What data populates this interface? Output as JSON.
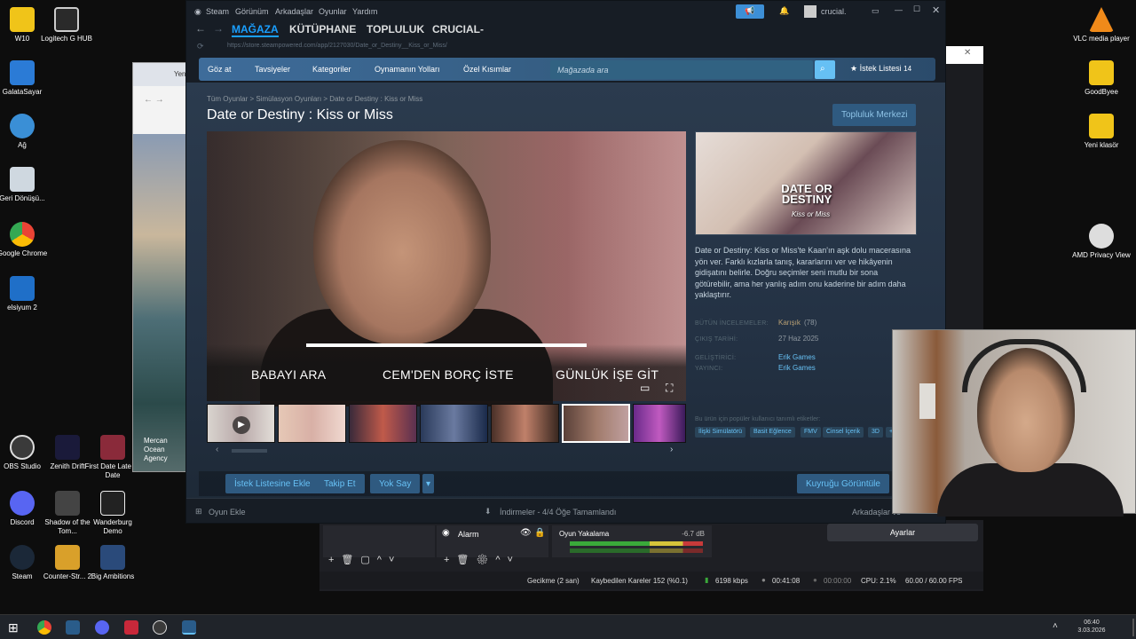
{
  "desktop": {
    "left_icons": [
      {
        "label": "W10",
        "color": "#f0c419"
      },
      {
        "label": "Logitech G HUB",
        "color": "#2a2a2a"
      },
      {
        "label": "GalataSayar",
        "color": "#2b7bd6"
      },
      {
        "label": "Ağ",
        "color": "#3a8fd6"
      },
      {
        "label": "Geri Dönüşü...",
        "color": "#cfd8e0"
      },
      {
        "label": "Google Chrome",
        "color": "#4285f4"
      },
      {
        "label": "elsiyum 2",
        "color": "#1f6fc8"
      },
      {
        "label": "OBS Studio",
        "color": "#3a3a3a"
      },
      {
        "label": "Zenith Drift",
        "color": "#1a1a3a"
      },
      {
        "label": "First Date Late To Date",
        "color": "#8a2a3a"
      },
      {
        "label": "Discord",
        "color": "#5865f2"
      },
      {
        "label": "Shadow of the Tom...",
        "color": "#444444"
      },
      {
        "label": "Wanderburg Demo",
        "color": "#222222"
      },
      {
        "label": "Steam",
        "color": "#1b2838"
      },
      {
        "label": "Counter-Str... 2",
        "color": "#d9a02a"
      },
      {
        "label": "Big Ambitions",
        "color": "#2a4a7a"
      }
    ],
    "right_icons": [
      {
        "label": "VLC media player",
        "color": "#f08a1a"
      },
      {
        "label": "GoodByee",
        "color": "#f0c419"
      },
      {
        "label": "Yeni klasör",
        "color": "#f0c419"
      },
      {
        "label": "AMD Privacy View",
        "color": "#dddddd"
      }
    ],
    "bg_window_tab": "Yen",
    "bg_window_side": "Mercan Ocean Agency"
  },
  "steam": {
    "menu": [
      "Steam",
      "Görünüm",
      "Arkadaşlar",
      "Oyunlar",
      "Yardım"
    ],
    "user": "crucial.",
    "main_tabs": [
      "MAĞAZA",
      "KÜTÜPHANE",
      "TOPLULUK",
      "CRUCIAL-"
    ],
    "url": "https://store.steampowered.com/app/2127030/Date_or_Destiny__Kiss_or_Miss/",
    "store_nav": [
      "Göz at",
      "Tavsiyeler",
      "Kategoriler",
      "Oynamanın Yolları",
      "Özel Kısımlar"
    ],
    "search_placeholder": "Mağazada ara",
    "wishlist_label": "İstek Listesi",
    "wishlist_count": "14",
    "breadcrumb": [
      "Tüm Oyunlar",
      "Simülasyon Oyunları",
      "Date or Destiny : Kiss or Miss"
    ],
    "game_title": "Date or Destiny : Kiss or Miss",
    "community_hub": "Topluluk Merkezi",
    "video_choices": [
      "BABAYI ARA",
      "CEM'DEN BORÇ İSTE",
      "GÜNLÜK İŞE GİT"
    ],
    "video_progress": 0.85,
    "capsule_title": "DATE OR DESTINY",
    "capsule_sub": "Kiss or Miss",
    "description": "Date or Destiny: Kiss or Miss'te Kaan'ın aşk dolu macerasına yön ver. Farklı kızlarla tanış, kararlarını ver ve hikâyenin gidişatını belirle. Doğru seçimler seni mutlu bir sona götürebilir, ama her yanlış adım onu kaderine bir adım daha yaklaştırır.",
    "meta": [
      {
        "label": "BÜTÜN İNCELEMELER:",
        "value": "Karışık",
        "extra": "(78)"
      },
      {
        "label": "ÇIKIŞ TARİHİ:",
        "value": "27 Haz 2025"
      },
      {
        "label": "GELİŞTİRİCİ:",
        "value": "Erik Games"
      },
      {
        "label": "YAYINCI:",
        "value": "Erik Games"
      }
    ],
    "tags_label": "Bu ürün için popüler kullanıcı tanımlı etiketler:",
    "tags": [
      "İlişki Simülatörü",
      "Basit Eğlence",
      "FMV",
      "Cinsel İçerik",
      "3D",
      "+"
    ],
    "actions": [
      "İstek Listesine Ekle",
      "Takip Et",
      "Yok Say"
    ],
    "queue_button": "Kuyruğu Görüntüle",
    "bottom_add_game": "Oyun Ekle",
    "bottom_downloads": "İndirmeler - 4/4 Öğe Tamamlandı",
    "bottom_friends": "Arkadaşlar ve"
  },
  "obs": {
    "source_alarm": "Alarm",
    "audio_source": "Oyun Yakalama",
    "audio_db": "-6.7 dB",
    "settings_btn": "Ayarlar",
    "status": {
      "delay": "Gecikme (2 san)",
      "dropped": "Kaybedilen Kareler 152 (%0.1)",
      "bitrate": "6198 kbps",
      "rec_time": "00:41:08",
      "stream_time": "00:00:00",
      "cpu": "CPU: 2.1%",
      "fps": "60.00 / 60.00 FPS"
    }
  },
  "taskbar": {
    "time": "06:40",
    "date": "3.03.2026"
  }
}
